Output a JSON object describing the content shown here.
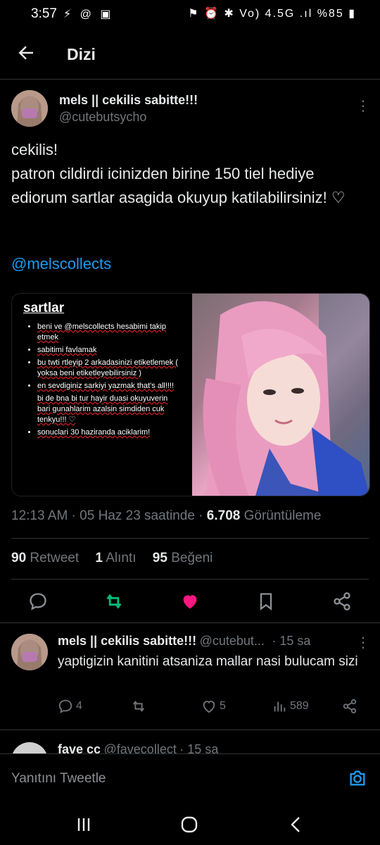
{
  "status_bar": {
    "time": "3:57",
    "left_icons": "⚡ @ ▣",
    "right_icons": "⚑ ⏰ ✱ Vo) 4.5G .ıl",
    "battery": "%85"
  },
  "header": {
    "title": "Dizi"
  },
  "tweet": {
    "name": "mels || cekilis sabitte!!!",
    "handle": "@cutebutsycho",
    "text": "cekilis!\npatron cildirdi icinizden birine 150 tiel hediye ediorum sartlar asagida okuyup katilabilirsiniz! ♡",
    "mention": "@melscollects",
    "media_rules": {
      "title": "sartlar",
      "items": [
        "beni ve @melscollects hesabimi takip etmek",
        "sabitimi favlamak",
        "bu twti rtleyip 2 arkadasinizi etiketlemek ( yoksa beni etiketleyebilirsiniz )",
        "en sevdiginiz sarkiyi yazmak that's all!!!!",
        "bi de bna bi tur hayir duasi okuyuverin bari gunahlarim azalsin simdiden cuk tenkyu!!! ♡",
        "sonuclari 30 haziranda aciklarim!"
      ]
    },
    "meta_time": "12:13 AM · 05 Haz 23 saatinde · ",
    "views": "6.708",
    "views_label": " Görüntüleme",
    "retweets": "90",
    "retweets_label": " Retweet",
    "quotes": "1",
    "quotes_label": " Alıntı",
    "likes": "95",
    "likes_label": " Beğeni"
  },
  "reply": {
    "name": "mels || cekilis sabitte!!!",
    "handle": "@cutebut...",
    "time": "· 15 sa",
    "text": "yaptigizin kanitini atsaniza mallar nasi bulucam sizi",
    "replies": "4",
    "likes": "5",
    "views": "589"
  },
  "next_reply": {
    "name": "fave cc",
    "handle": "@favecollect",
    "time": "· 15 sa"
  },
  "compose": {
    "placeholder": "Yanıtını Tweetle"
  },
  "colors": {
    "accent": "#1d9bf0",
    "retweet": "#00ba7c",
    "like": "#f91880",
    "muted": "#71767b"
  }
}
